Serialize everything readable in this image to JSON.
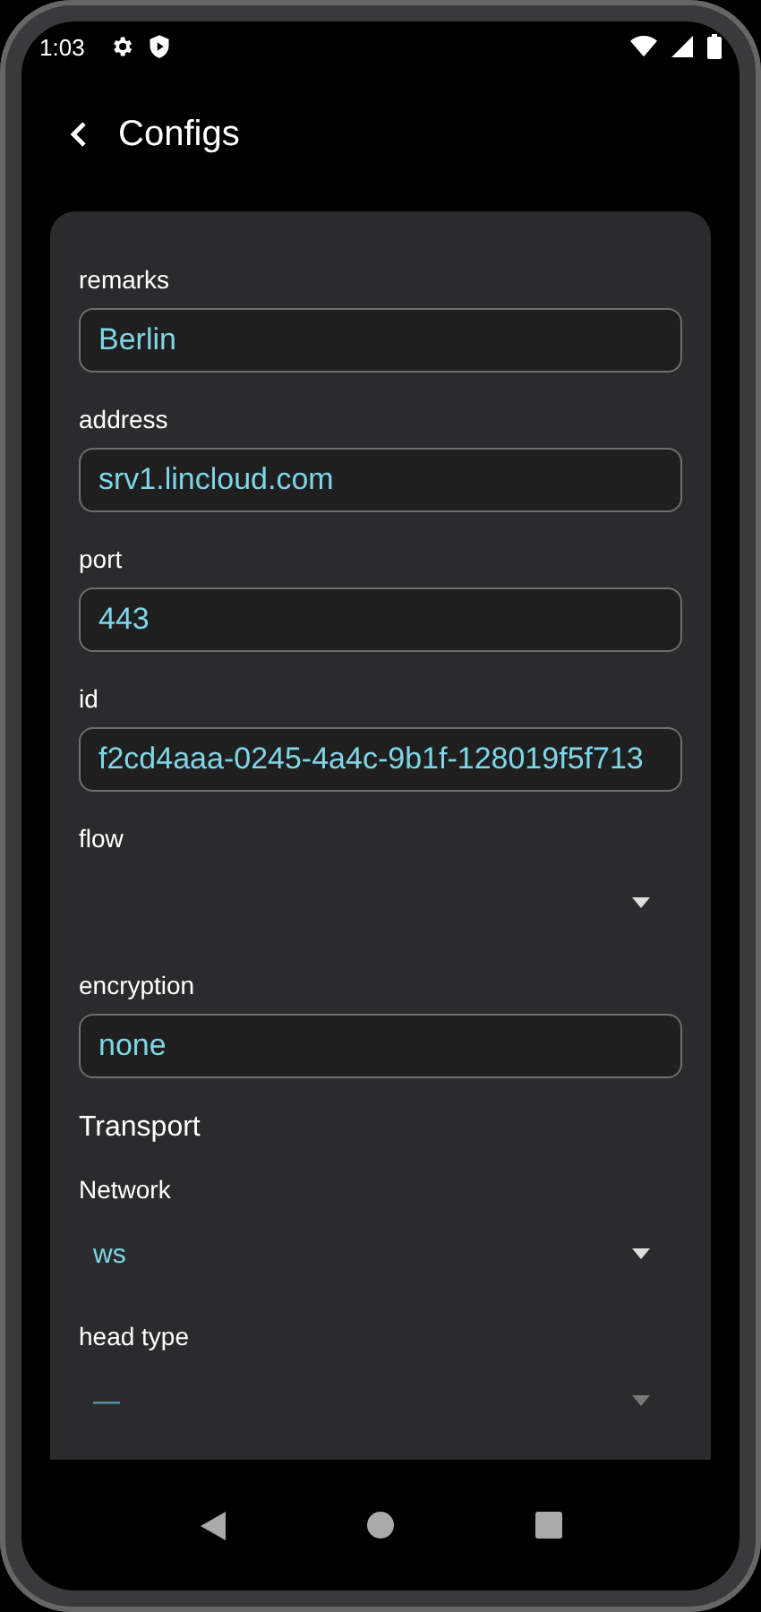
{
  "status_bar": {
    "time": "1:03"
  },
  "app_bar": {
    "title": "Configs"
  },
  "form": [
    {
      "kind": "text",
      "label": "remarks",
      "value": "Berlin"
    },
    {
      "kind": "text",
      "label": "address",
      "value": "srv1.lincloud.com"
    },
    {
      "kind": "text",
      "label": "port",
      "value": "443"
    },
    {
      "kind": "text",
      "label": "id",
      "value": "f2cd4aaa-0245-4a4c-9b1f-128019f5f713"
    },
    {
      "kind": "select",
      "label": "flow",
      "disabled": false
    },
    {
      "kind": "text",
      "label": "encryption",
      "value": "none"
    },
    {
      "kind": "section",
      "title": "Transport"
    },
    {
      "kind": "select",
      "label": "Network",
      "value": "ws",
      "disabled": false
    },
    {
      "kind": "select",
      "label": "head type",
      "value": "—",
      "disabled": true
    }
  ]
}
